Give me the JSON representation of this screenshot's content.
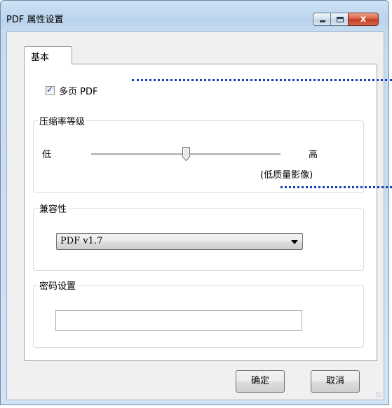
{
  "window": {
    "title": "PDF 属性设置",
    "caption_buttons": {
      "minimize": "minimize-icon",
      "maximize": "maximize-icon",
      "close": "close-icon"
    },
    "close_glyph": "x"
  },
  "tabs": [
    {
      "label": "基本",
      "selected": true
    }
  ],
  "multipage": {
    "label": "多页 PDF",
    "checked": true
  },
  "compression": {
    "legend": "压缩率等级",
    "low_label": "低",
    "high_label": "高",
    "note": "(低质量影像)",
    "level_fraction": 0.5
  },
  "compat": {
    "legend": "兼容性",
    "selected": "PDF v1.7"
  },
  "password": {
    "legend": "密码设置",
    "value": ""
  },
  "buttons": {
    "ok": "确定",
    "cancel": "取消"
  },
  "colors": {
    "annotation_dots": "#1540b8",
    "title_bar": "#bad3ec",
    "close_button": "#c1391f"
  }
}
